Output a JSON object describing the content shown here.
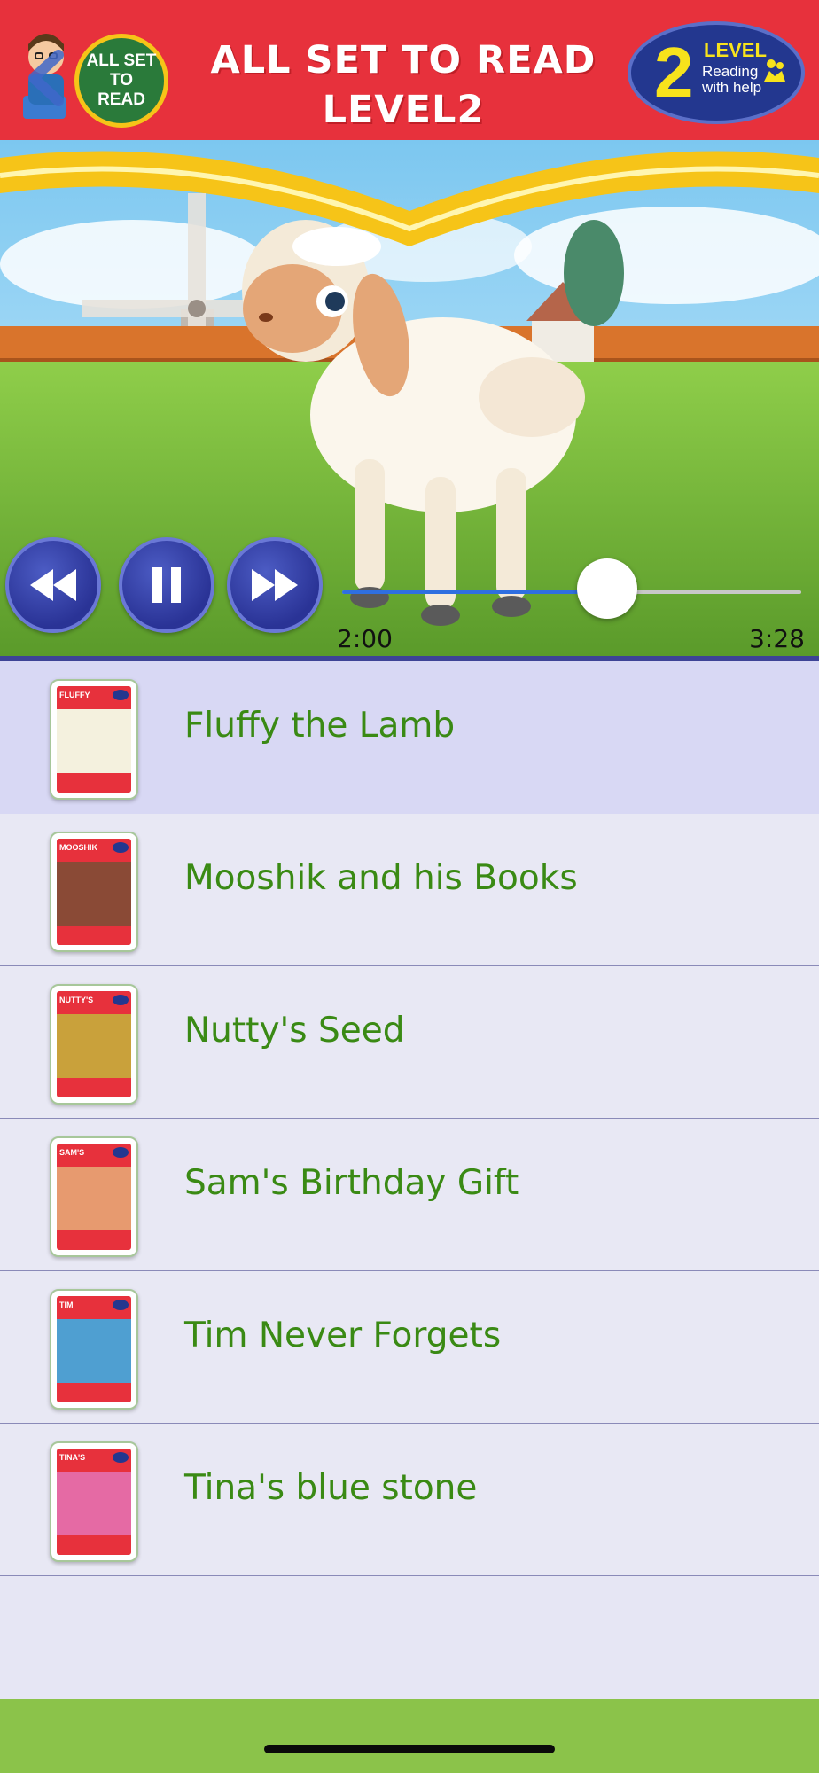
{
  "header": {
    "badge_text": "ALL SET TO READ",
    "title": "ALL SET TO READ LEVEL2",
    "level_word": "LEVEL",
    "level_number": "2",
    "level_subtitle": "Reading with help"
  },
  "player": {
    "time_elapsed": "2:00",
    "time_total": "3:28",
    "progress": 0.577
  },
  "stories": [
    {
      "title": "Fluffy the Lamb",
      "cover_label": "FLUFFY",
      "cover_art_color": "#f4f1de",
      "selected": true
    },
    {
      "title": "Mooshik and his Books",
      "cover_label": "MOOSHIK",
      "cover_art_color": "#8a4a36",
      "selected": false
    },
    {
      "title": "Nutty's Seed",
      "cover_label": "NUTTY'S",
      "cover_art_color": "#c9a13b",
      "selected": false
    },
    {
      "title": "Sam's Birthday Gift",
      "cover_label": "SAM'S",
      "cover_art_color": "#e79a6f",
      "selected": false
    },
    {
      "title": "Tim Never Forgets",
      "cover_label": "TIM",
      "cover_art_color": "#4f9fd1",
      "selected": false
    },
    {
      "title": "Tina's blue stone",
      "cover_label": "TINA'S",
      "cover_art_color": "#e56aa4",
      "selected": false
    }
  ],
  "colors": {
    "header_bg": "#e7313c",
    "accent_blue": "#23378f",
    "title_green": "#3a8a14",
    "footer_green": "#8bc34a"
  },
  "icons": {
    "rewind": "rewind-icon",
    "pause": "pause-icon",
    "forward": "fast-forward-icon"
  }
}
